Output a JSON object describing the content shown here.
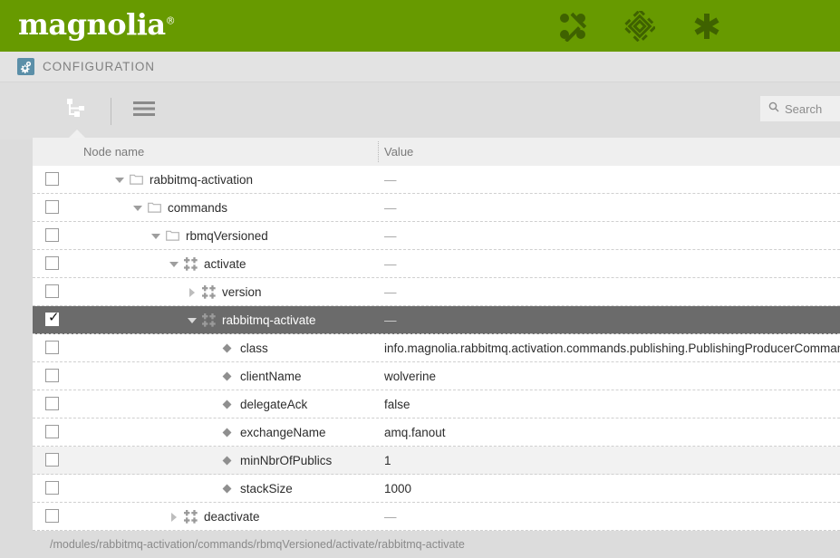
{
  "brand": {
    "name": "magnolia",
    "registered": "®",
    "green": "#679a00"
  },
  "header_icons": [
    {
      "name": "node-graph-icon",
      "label": "Pulse"
    },
    {
      "name": "diamond-pattern-icon",
      "label": "Apps"
    },
    {
      "name": "asterisk-icon",
      "label": "Favorites"
    }
  ],
  "appbar": {
    "icon_name": "gears-icon",
    "title": "CONFIGURATION",
    "icon_color": "#5b8fa8"
  },
  "toolbar": {
    "tree_view_label": "Tree view",
    "list_view_label": "List view",
    "active_view": "tree"
  },
  "search": {
    "placeholder": "Search",
    "value": ""
  },
  "table": {
    "columns": [
      "Node name",
      "Value"
    ],
    "rows": [
      {
        "label": "rabbitmq-activation",
        "value": "—",
        "indent": 0,
        "icon": "folder",
        "twisty": "down",
        "checked": false,
        "selected": false,
        "alt": false
      },
      {
        "label": "commands",
        "value": "—",
        "indent": 1,
        "icon": "folder",
        "twisty": "down",
        "checked": false,
        "selected": false,
        "alt": false
      },
      {
        "label": "rbmqVersioned",
        "value": "—",
        "indent": 2,
        "icon": "folder",
        "twisty": "down",
        "checked": false,
        "selected": false,
        "alt": false
      },
      {
        "label": "activate",
        "value": "—",
        "indent": 3,
        "icon": "node",
        "twisty": "down",
        "checked": false,
        "selected": false,
        "alt": false
      },
      {
        "label": "version",
        "value": "—",
        "indent": 4,
        "icon": "node",
        "twisty": "right",
        "checked": false,
        "selected": false,
        "alt": false
      },
      {
        "label": "rabbitmq-activate",
        "value": "—",
        "indent": 4,
        "icon": "node",
        "twisty": "down",
        "checked": true,
        "selected": true,
        "alt": false
      },
      {
        "label": "class",
        "value": "info.magnolia.rabbitmq.activation.commands.publishing.PublishingProducerCommand",
        "indent": 5,
        "icon": "property",
        "twisty": "none",
        "checked": false,
        "selected": false,
        "alt": false
      },
      {
        "label": "clientName",
        "value": "wolverine",
        "indent": 5,
        "icon": "property",
        "twisty": "none",
        "checked": false,
        "selected": false,
        "alt": false
      },
      {
        "label": "delegateAck",
        "value": "false",
        "indent": 5,
        "icon": "property",
        "twisty": "none",
        "checked": false,
        "selected": false,
        "alt": false
      },
      {
        "label": "exchangeName",
        "value": "amq.fanout",
        "indent": 5,
        "icon": "property",
        "twisty": "none",
        "checked": false,
        "selected": false,
        "alt": false
      },
      {
        "label": "minNbrOfPublics",
        "value": "1",
        "indent": 5,
        "icon": "property",
        "twisty": "none",
        "checked": false,
        "selected": false,
        "alt": true
      },
      {
        "label": "stackSize",
        "value": "1000",
        "indent": 5,
        "icon": "property",
        "twisty": "none",
        "checked": false,
        "selected": false,
        "alt": false
      },
      {
        "label": "deactivate",
        "value": "—",
        "indent": 3,
        "icon": "node",
        "twisty": "right",
        "checked": false,
        "selected": false,
        "alt": false
      }
    ]
  },
  "statusbar": {
    "path": "/modules/rabbitmq-activation/commands/rbmqVersioned/activate/rabbitmq-activate"
  }
}
